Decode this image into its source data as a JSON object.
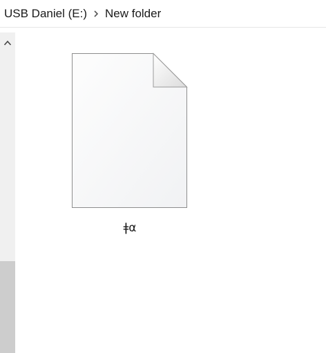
{
  "breadcrumb": {
    "items": [
      {
        "label": "USB Daniel (E:)"
      },
      {
        "label": "New folder"
      }
    ]
  },
  "file": {
    "name": "ǂα",
    "icon": "blank-document-icon"
  },
  "scrollbar": {
    "up_icon": "chevron-up-icon"
  },
  "colors": {
    "scrollbar_track": "#f0f0f0",
    "scrollbar_thumb": "#cdcdcd",
    "divider": "#e5e5e5"
  }
}
